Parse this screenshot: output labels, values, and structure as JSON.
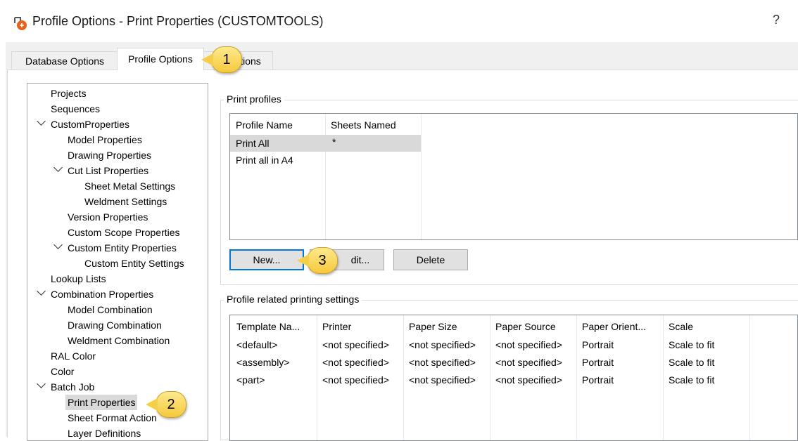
{
  "window": {
    "title": "Profile Options - Print Properties (CUSTOMTOOLS)",
    "help": "?"
  },
  "tabs": [
    {
      "label": "Database Options"
    },
    {
      "label": "Profile Options"
    },
    {
      "label": "User Options",
      "visible_label": "tions"
    }
  ],
  "tree": [
    {
      "label": "Projects"
    },
    {
      "label": "Sequences"
    },
    {
      "label": "CustomProperties"
    },
    {
      "label": "Model Properties"
    },
    {
      "label": "Drawing Properties"
    },
    {
      "label": "Cut List Properties"
    },
    {
      "label": "Sheet Metal Settings"
    },
    {
      "label": "Weldment Settings"
    },
    {
      "label": "Version Properties"
    },
    {
      "label": "Custom Scope Properties"
    },
    {
      "label": "Custom Entity Properties"
    },
    {
      "label": "Custom Entity Settings"
    },
    {
      "label": "Lookup Lists"
    },
    {
      "label": "Combination Properties"
    },
    {
      "label": "Model Combination"
    },
    {
      "label": "Drawing Combination"
    },
    {
      "label": "Weldment Combination"
    },
    {
      "label": "RAL Color"
    },
    {
      "label": "Color"
    },
    {
      "label": "Batch Job"
    },
    {
      "label": "Print Properties"
    },
    {
      "label": "Sheet Format Action"
    },
    {
      "label": "Layer Definitions"
    }
  ],
  "print_profiles": {
    "title": "Print profiles",
    "columns": [
      "Profile Name",
      "Sheets Named"
    ],
    "rows": [
      [
        "Print All",
        "*"
      ],
      [
        "Print all in A4",
        ""
      ]
    ],
    "buttons": {
      "new": "New...",
      "edit": "dit...",
      "delete": "Delete"
    }
  },
  "settings": {
    "title": "Profile related printing settings",
    "columns": [
      "Template Na...",
      "Printer",
      "Paper Size",
      "Paper Source",
      "Paper Orient...",
      "Scale"
    ],
    "rows": [
      [
        "<default>",
        "<not specified>",
        "<not specified>",
        "<not specified>",
        "Portrait",
        "Scale to fit"
      ],
      [
        "<assembly>",
        "<not specified>",
        "<not specified>",
        "<not specified>",
        "Portrait",
        "Scale to fit"
      ],
      [
        "<part>",
        "<not specified>",
        "<not specified>",
        "<not specified>",
        "Portrait",
        "Scale to fit"
      ]
    ]
  },
  "callouts": [
    "1",
    "2",
    "3"
  ],
  "colors": {
    "selection": "#d9d9d9",
    "accent": "#0078d7",
    "callout": "#f6c93c"
  }
}
